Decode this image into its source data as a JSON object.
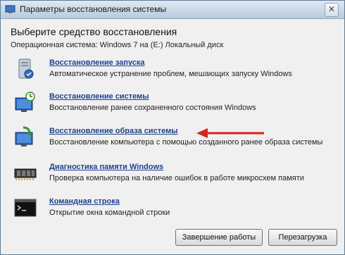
{
  "window": {
    "title": "Параметры восстановления системы",
    "close_label": "✕"
  },
  "main": {
    "heading": "Выберите средство восстановления",
    "os_info": "Операционная система: Windows 7 на (E:) Локальный диск"
  },
  "tools": [
    {
      "label": "Восстановление запуска",
      "description": "Автоматическое устранение проблем, мешающих запуску Windows",
      "icon": "startup-repair-icon"
    },
    {
      "label": "Восстановление системы",
      "description": "Восстановление ранее сохраненного состояния Windows",
      "icon": "system-restore-icon"
    },
    {
      "label": "Восстановление образа системы",
      "description": "Восстановление компьютера с помощью  созданного ранее образа системы",
      "icon": "system-image-recovery-icon"
    },
    {
      "label": "Диагностика памяти Windows",
      "description": "Проверка компьютера на наличие ошибок в работе микросхем памяти",
      "icon": "memory-diagnostic-icon"
    },
    {
      "label": "Командная строка",
      "description": "Открытие окна командной строки",
      "icon": "command-prompt-icon"
    }
  ],
  "buttons": {
    "shutdown": "Завершение работы",
    "restart": "Перезагрузка"
  },
  "annotation": {
    "arrow_color": "#e0201a"
  }
}
